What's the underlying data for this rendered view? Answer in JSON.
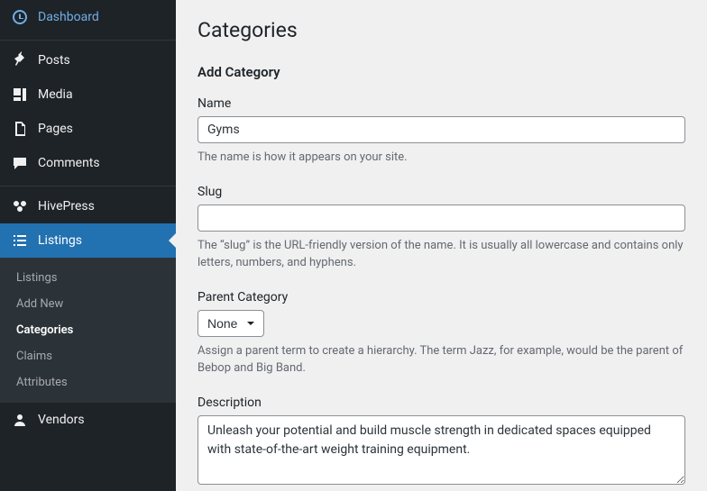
{
  "sidebar": {
    "dashboard": "Dashboard",
    "posts": "Posts",
    "media": "Media",
    "pages": "Pages",
    "comments": "Comments",
    "hivepress": "HivePress",
    "listings": "Listings",
    "vendors": "Vendors",
    "submenu": {
      "listings": "Listings",
      "addnew": "Add New",
      "categories": "Categories",
      "claims": "Claims",
      "attributes": "Attributes"
    }
  },
  "page": {
    "title": "Categories",
    "formTitle": "Add Category",
    "fields": {
      "name": {
        "label": "Name",
        "value": "Gyms",
        "help": "The name is how it appears on your site."
      },
      "slug": {
        "label": "Slug",
        "value": "",
        "help": "The “slug” is the URL-friendly version of the name. It is usually all lowercase and contains only letters, numbers, and hyphens."
      },
      "parent": {
        "label": "Parent Category",
        "selected": "None",
        "help": "Assign a parent term to create a hierarchy. The term Jazz, for example, would be the parent of Bebop and Big Band."
      },
      "description": {
        "label": "Description",
        "value": "Unleash your potential and build muscle strength in dedicated spaces equipped with state-of-the-art weight training equipment."
      }
    }
  }
}
